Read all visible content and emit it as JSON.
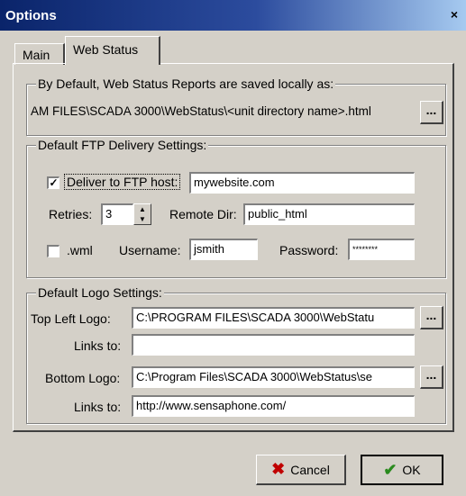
{
  "window": {
    "title": "Options",
    "close_glyph": "×"
  },
  "tabs": [
    {
      "label": "Main"
    },
    {
      "label": "Web Status"
    }
  ],
  "save_group": {
    "legend": "By Default, Web Status Reports are saved locally as:",
    "path": "AM FILES\\SCADA 3000\\WebStatus\\<unit directory name>.html",
    "browse_label": "..."
  },
  "ftp_group": {
    "legend": "Default FTP Delivery Settings:",
    "deliver_checked": true,
    "deliver_label": "Deliver to FTP host:",
    "host_value": "mywebsite.com",
    "retries_label": "Retries:",
    "retries_value": "3",
    "remote_dir_label": "Remote Dir:",
    "remote_dir_value": "public_html",
    "wml_checked": false,
    "wml_label": ".wml",
    "username_label": "Username:",
    "username_value": "jsmith",
    "password_label": "Password:",
    "password_value": "********"
  },
  "logo_group": {
    "legend": "Default Logo Settings:",
    "top_left_label": "Top Left Logo:",
    "top_left_value": "C:\\PROGRAM FILES\\SCADA 3000\\WebStatu",
    "top_links_label": "Links to:",
    "top_links_value": "",
    "bottom_label": "Bottom Logo:",
    "bottom_value": "C:\\Program Files\\SCADA 3000\\WebStatus\\se",
    "bottom_links_label": "Links to:",
    "bottom_links_value": "http://www.sensaphone.com/",
    "browse_label": "..."
  },
  "buttons": {
    "cancel_label": "Cancel",
    "ok_label": "OK",
    "cancel_icon_color": "#c00000",
    "ok_icon_color": "#2a8a1e"
  },
  "colors": {
    "titlebar_start": "#0a246a",
    "titlebar_end": "#a6caf0",
    "face": "#d4d0c8"
  }
}
